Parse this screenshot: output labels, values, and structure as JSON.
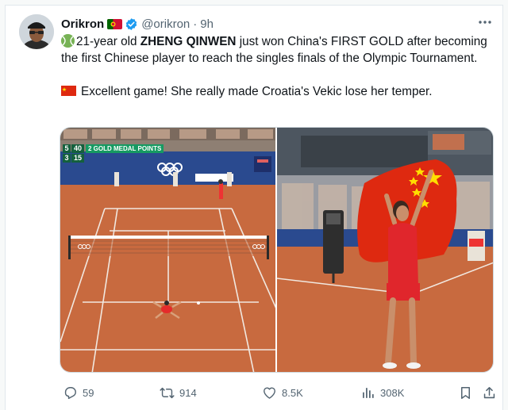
{
  "author": {
    "name": "Orikron",
    "handle": "@orikron",
    "separator": "·",
    "time": "9h"
  },
  "tweet": {
    "line1_prefix": "21-year old ",
    "line1_bold": "ZHENG QINWEN",
    "line1_rest": " just won China's FIRST GOLD after becoming the first Chinese player to reach the singles finals of the Olympic Tournament.",
    "line2": "Excellent game! She really made Croatia's Vekic lose her temper."
  },
  "scoreboard": {
    "row1_a": "5",
    "row1_b": "40",
    "banner": "2 GOLD MEDAL POINTS",
    "row2_a": "3",
    "row2_b": "15"
  },
  "actions": {
    "replies": "59",
    "reposts": "914",
    "likes": "8.5K",
    "views": "308K"
  },
  "colors": {
    "clay": "#c86a3f",
    "blue_wall": "#2a4a8f",
    "accent_blue": "#1d9bf0",
    "muted": "#536471",
    "china_red": "#de2910",
    "china_yellow": "#ffde00"
  }
}
